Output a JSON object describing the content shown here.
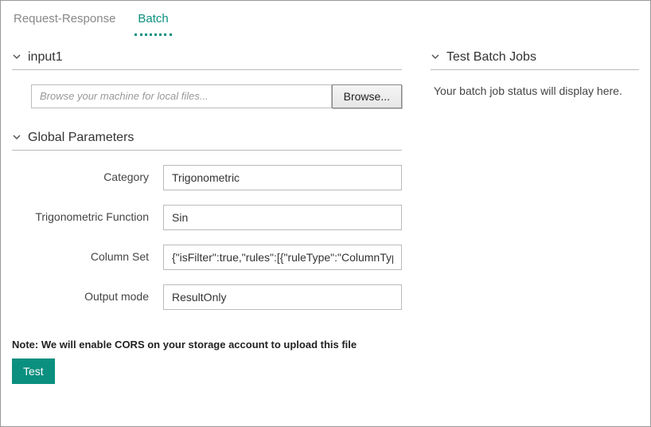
{
  "tabs": {
    "request_response": "Request-Response",
    "batch": "Batch"
  },
  "sections": {
    "input1": {
      "title": "input1"
    },
    "global_params": {
      "title": "Global Parameters"
    },
    "test_batch_jobs": {
      "title": "Test Batch Jobs"
    }
  },
  "file_browser": {
    "placeholder": "Browse your machine for local files...",
    "browse_label": "Browse..."
  },
  "params": {
    "category": {
      "label": "Category",
      "value": "Trigonometric"
    },
    "trig_function": {
      "label": "Trigonometric Function",
      "value": "Sin"
    },
    "column_set": {
      "label": "Column Set",
      "value": "{\"isFilter\":true,\"rules\":[{\"ruleType\":\"ColumnTyp"
    },
    "output_mode": {
      "label": "Output mode",
      "value": "ResultOnly"
    }
  },
  "note": "Note: We will enable CORS on your storage account to upload this file",
  "test_button": "Test",
  "batch_status": "Your batch job status will display here."
}
